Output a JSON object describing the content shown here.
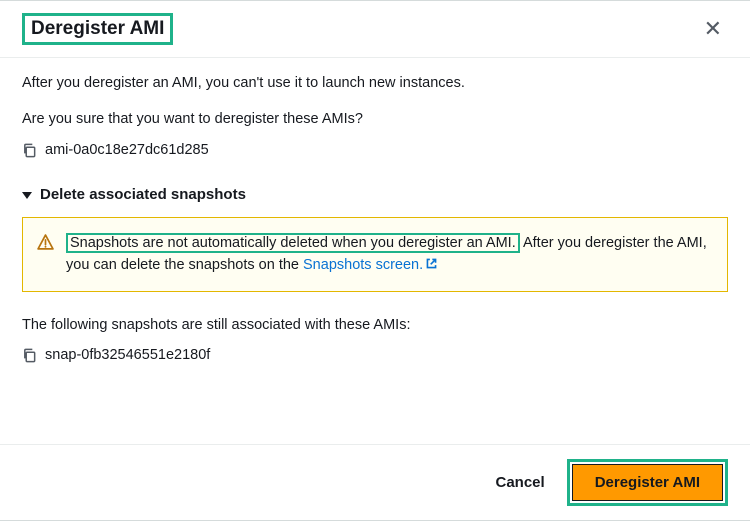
{
  "header": {
    "title": "Deregister AMI"
  },
  "body": {
    "intro": "After you deregister an AMI, you can't use it to launch new instances.",
    "confirm_q": "Are you sure that you want to deregister these AMIs?",
    "ami_id": "ami-0a0c18e27dc61d285",
    "expander_label": "Delete associated snapshots",
    "alert_highlight": "Snapshots are not automatically deleted when you deregister an AMI.",
    "alert_rest_pre": " After you deregister the AMI, you can delete the snapshots on the ",
    "alert_link": "Snapshots screen.",
    "assoc_label": "The following snapshots are still associated with these AMIs:",
    "snapshot_id": "snap-0fb32546551e2180f"
  },
  "footer": {
    "cancel": "Cancel",
    "primary": "Deregister AMI"
  }
}
